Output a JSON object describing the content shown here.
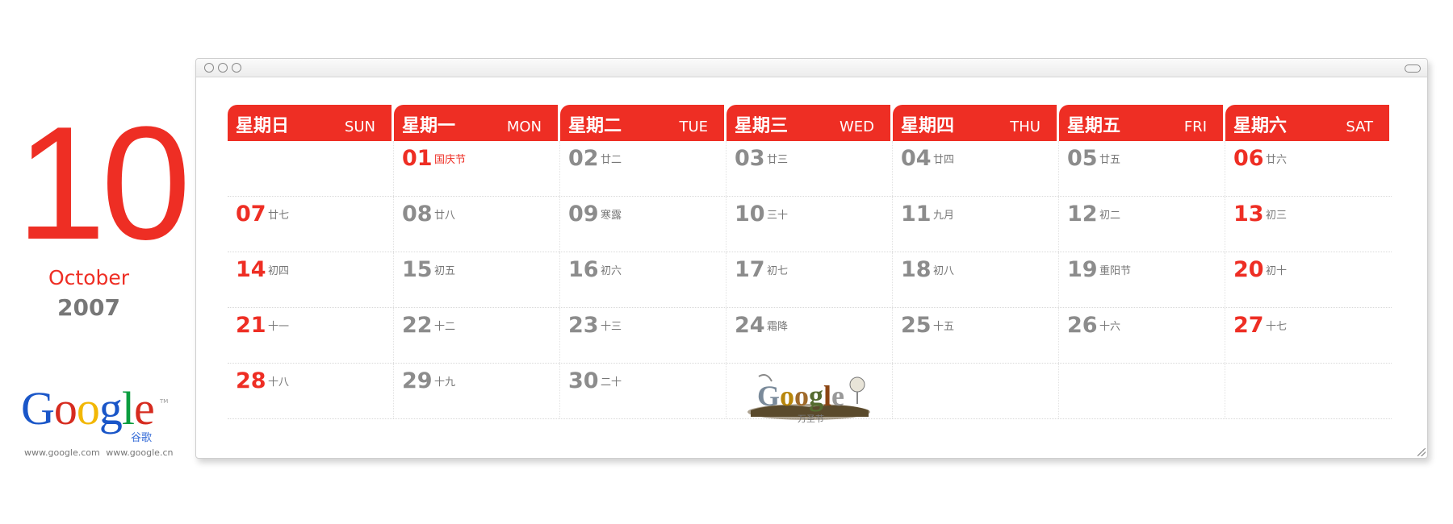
{
  "left_panel": {
    "month_number": "10",
    "month_name": "October",
    "year": "2007",
    "logo": {
      "letters": [
        "G",
        "o",
        "o",
        "g",
        "l",
        "e"
      ],
      "letter_colors": [
        "#1a56c8",
        "#d62b1f",
        "#f2b705",
        "#1a56c8",
        "#0b9d3f",
        "#d62b1f"
      ],
      "subtitle": "谷歌",
      "tm": "TM"
    },
    "urls": [
      "www.google.com",
      "www.google.cn"
    ]
  },
  "colors": {
    "accent": "#ee2e24",
    "gray_text": "#8c8c8c"
  },
  "weekdays": [
    {
      "cn": "星期日",
      "en": "SUN"
    },
    {
      "cn": "星期一",
      "en": "MON"
    },
    {
      "cn": "星期二",
      "en": "TUE"
    },
    {
      "cn": "星期三",
      "en": "WED"
    },
    {
      "cn": "星期四",
      "en": "THU"
    },
    {
      "cn": "星期五",
      "en": "FRI"
    },
    {
      "cn": "星期六",
      "en": "SAT"
    }
  ],
  "weeks": [
    [
      null,
      {
        "day": "01",
        "lunar": "国庆节",
        "red": true,
        "lunar_red": true
      },
      {
        "day": "02",
        "lunar": "廿二"
      },
      {
        "day": "03",
        "lunar": "廿三"
      },
      {
        "day": "04",
        "lunar": "廿四"
      },
      {
        "day": "05",
        "lunar": "廿五"
      },
      {
        "day": "06",
        "lunar": "廿六",
        "red": true
      }
    ],
    [
      {
        "day": "07",
        "lunar": "廿七",
        "red": true
      },
      {
        "day": "08",
        "lunar": "廿八"
      },
      {
        "day": "09",
        "lunar": "寒露"
      },
      {
        "day": "10",
        "lunar": "三十"
      },
      {
        "day": "11",
        "lunar": "九月"
      },
      {
        "day": "12",
        "lunar": "初二"
      },
      {
        "day": "13",
        "lunar": "初三",
        "red": true
      }
    ],
    [
      {
        "day": "14",
        "lunar": "初四",
        "red": true
      },
      {
        "day": "15",
        "lunar": "初五"
      },
      {
        "day": "16",
        "lunar": "初六"
      },
      {
        "day": "17",
        "lunar": "初七"
      },
      {
        "day": "18",
        "lunar": "初八"
      },
      {
        "day": "19",
        "lunar": "重阳节"
      },
      {
        "day": "20",
        "lunar": "初十",
        "red": true
      }
    ],
    [
      {
        "day": "21",
        "lunar": "十一",
        "red": true
      },
      {
        "day": "22",
        "lunar": "十二"
      },
      {
        "day": "23",
        "lunar": "十三"
      },
      {
        "day": "24",
        "lunar": "霜降"
      },
      {
        "day": "25",
        "lunar": "十五"
      },
      {
        "day": "26",
        "lunar": "十六"
      },
      {
        "day": "27",
        "lunar": "十七",
        "red": true
      }
    ],
    [
      {
        "day": "28",
        "lunar": "十八",
        "red": true
      },
      {
        "day": "29",
        "lunar": "十九"
      },
      {
        "day": "30",
        "lunar": "二十"
      },
      {
        "doodle": true,
        "caption": "万圣节"
      },
      null,
      null,
      null
    ]
  ]
}
